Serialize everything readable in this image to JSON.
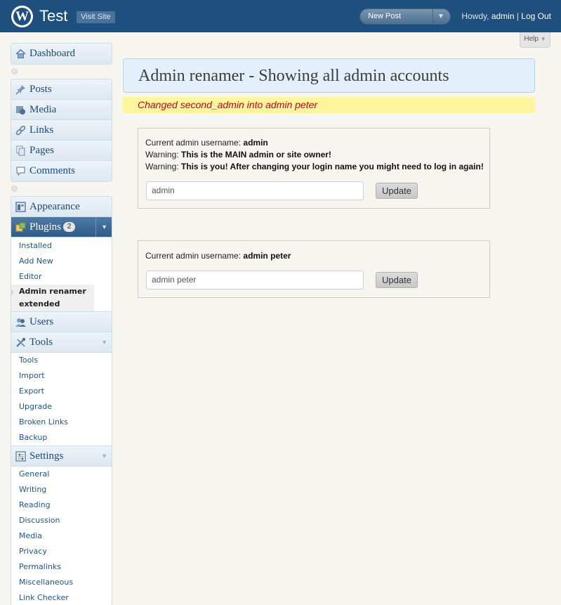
{
  "header": {
    "site_title": "Test",
    "visit_site": "Visit Site",
    "new_post": "New Post",
    "howdy_prefix": "Howdy, ",
    "user_name": "admin",
    "separator": " | ",
    "logout": "Log Out",
    "bg_color": "#1f4f7c"
  },
  "help": {
    "label": "Help"
  },
  "sidebar": {
    "dashboard": "Dashboard",
    "group1": [
      "Posts",
      "Media",
      "Links",
      "Pages",
      "Comments"
    ],
    "appearance": "Appearance",
    "plugins": {
      "label": "Plugins",
      "badge": "2"
    },
    "plugins_sub": [
      "Installed",
      "Add New",
      "Editor",
      "Admin renamer extended"
    ],
    "users": "Users",
    "tools": "Tools",
    "tools_sub": [
      "Tools",
      "Import",
      "Export",
      "Upgrade",
      "Broken Links",
      "Backup"
    ],
    "settings": "Settings",
    "settings_sub": [
      "General",
      "Writing",
      "Reading",
      "Discussion",
      "Media",
      "Privacy",
      "Permalinks",
      "Miscellaneous",
      "Link Checker"
    ]
  },
  "main": {
    "page_title": "Admin renamer - Showing all admin accounts",
    "notice": "Changed second_admin into admin peter",
    "accounts": [
      {
        "label": "Current admin username: ",
        "username": "admin",
        "warning_label": "Warning: ",
        "warning_1": "This is the MAIN admin or site owner!",
        "warning_2": "This is you! After changing your login name you might need to log in again!",
        "input_value": "admin",
        "button": "Update"
      },
      {
        "label": "Current admin username: ",
        "username": "admin peter",
        "input_value": "admin peter",
        "button": "Update"
      }
    ],
    "notice_color": "#fff59f",
    "notice_text_color": "#c2001f"
  }
}
